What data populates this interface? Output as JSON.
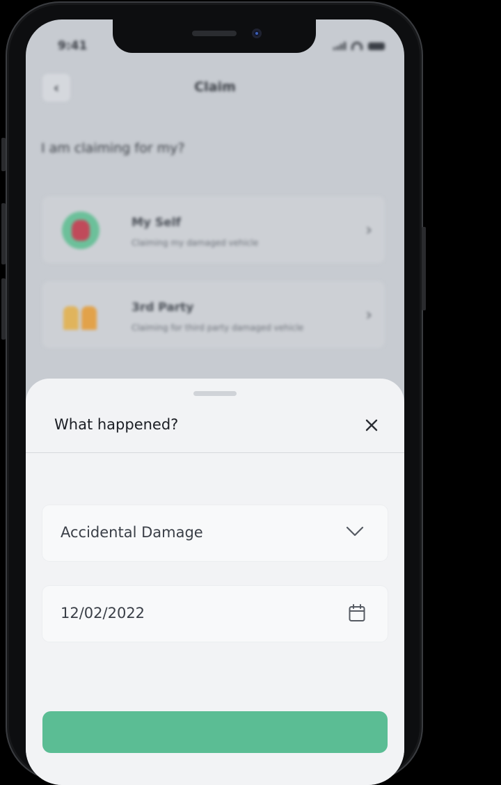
{
  "status_bar": {
    "time": "9:41"
  },
  "header": {
    "back_icon": "chevron-left-icon",
    "title": "Claim"
  },
  "question": "I am claiming for my?",
  "options": [
    {
      "title": "My Self",
      "subtitle": "Claiming my damaged vehicle",
      "icon": "avatar-icon"
    },
    {
      "title": "3rd Party",
      "subtitle": "Claiming for third party damaged vehicle",
      "icon": "people-icon"
    }
  ],
  "sheet": {
    "title": "What happened?",
    "close_icon": "close-icon",
    "incident_type": "Accidental Damage",
    "incident_date": "12/02/2022"
  },
  "colors": {
    "accent": "#5bbd94",
    "sheet_bg": "#f2f3f5",
    "overlay": "#c7cbd1"
  }
}
